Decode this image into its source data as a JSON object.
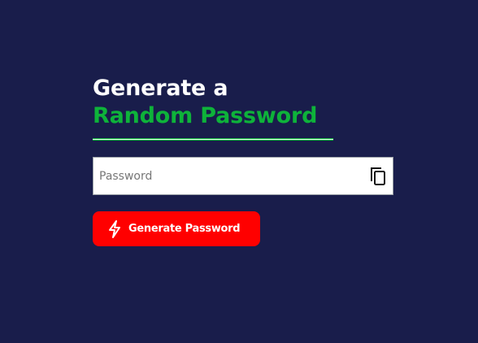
{
  "title": {
    "line1": "Generate a",
    "line2": "Random Password"
  },
  "password_field": {
    "value": "",
    "placeholder": "Password",
    "copy_icon": "copy-icon"
  },
  "generate_button": {
    "label": "Generate Password",
    "icon": "bolt-icon"
  },
  "colors": {
    "background": "#191d4b",
    "accent_green": "#0eb33a",
    "button_red": "#ff0000"
  }
}
